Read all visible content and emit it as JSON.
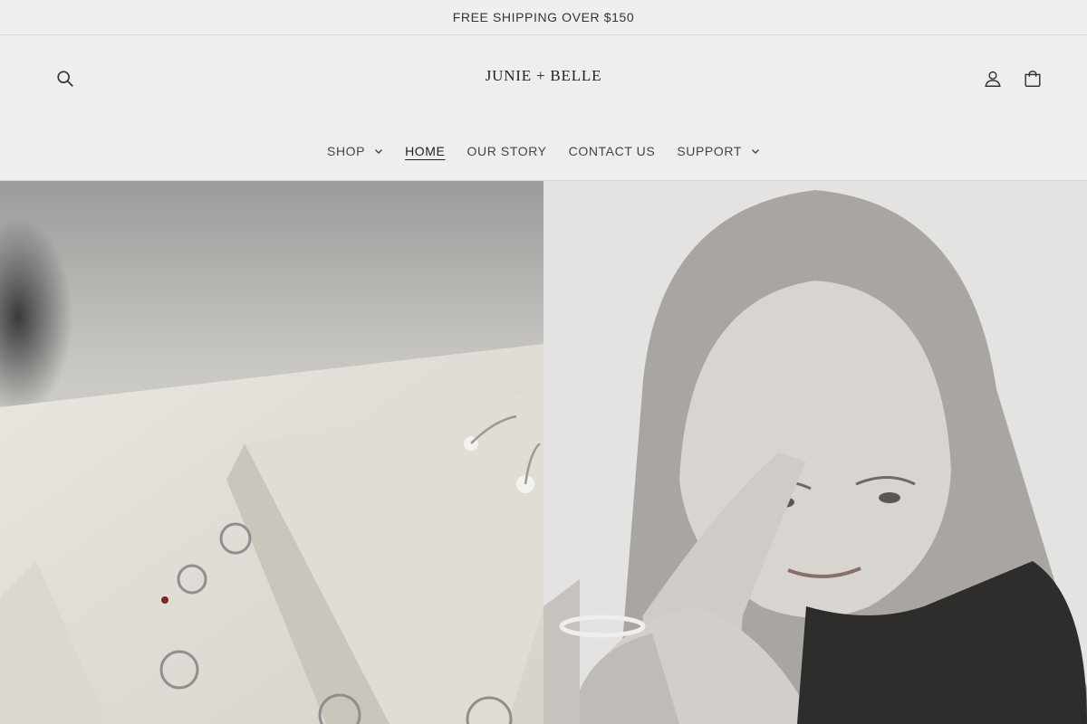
{
  "announcement": {
    "text": "FREE SHIPPING OVER $150"
  },
  "header": {
    "logo": "JUNIE + BELLE",
    "icons": {
      "search": "search-icon",
      "account": "account-icon",
      "cart": "cart-icon"
    }
  },
  "nav": {
    "items": [
      {
        "label": "SHOP",
        "dropdown": true,
        "active": false
      },
      {
        "label": "HOME",
        "dropdown": false,
        "active": true
      },
      {
        "label": "OUR STORY",
        "dropdown": false,
        "active": false
      },
      {
        "label": "CONTACT US",
        "dropdown": false,
        "active": false
      },
      {
        "label": "SUPPORT",
        "dropdown": true,
        "active": false
      }
    ]
  },
  "hero": {
    "left_image": "earrings-on-stone-photo",
    "right_image": "woman-portrait-photo"
  },
  "colors": {
    "background": "#efeeec",
    "text": "#2a2a2a"
  }
}
